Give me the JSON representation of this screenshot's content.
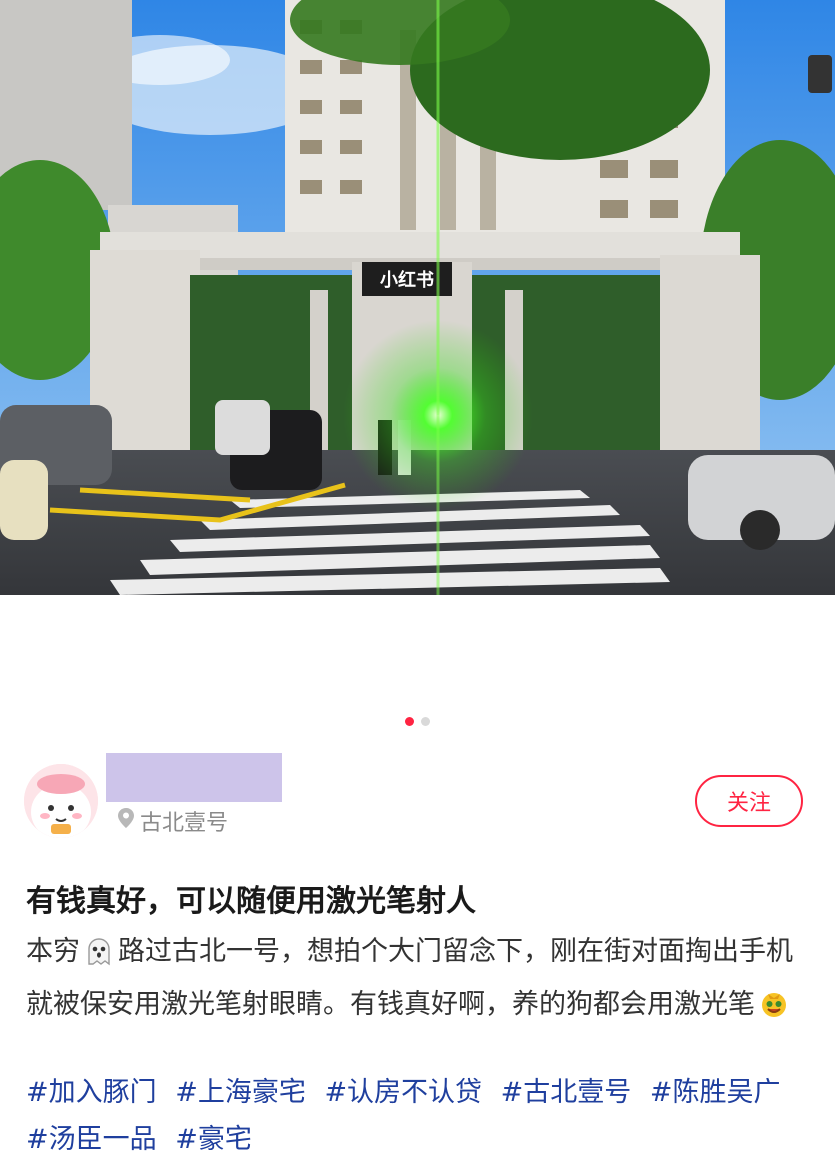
{
  "photo": {
    "sign_text": "小红书",
    "description_icon": "building-gate-photo"
  },
  "carousel": {
    "total": 2,
    "active": 1
  },
  "author": {
    "location": "古北壹号",
    "location_icon": "location-pin-icon"
  },
  "follow_label": "关注",
  "post": {
    "title": "有钱真好，可以随便用激光笔射人",
    "body_part1": "本穷",
    "body_part2": "路过古北一号，想拍个大门留念下，刚在街对面掏出手机就被保安用激光笔射眼睛。有钱真好啊，养的狗都会用激光笔",
    "tags": [
      "#加入豚门",
      "#上海豪宅",
      "#认房不认贷",
      "#古北壹号",
      "#陈胜吴广",
      "#汤臣一品",
      "#豪宅"
    ]
  },
  "colors": {
    "accent": "#ff2442",
    "tag": "#1f3f9e",
    "redact": "#cdc4ea"
  }
}
